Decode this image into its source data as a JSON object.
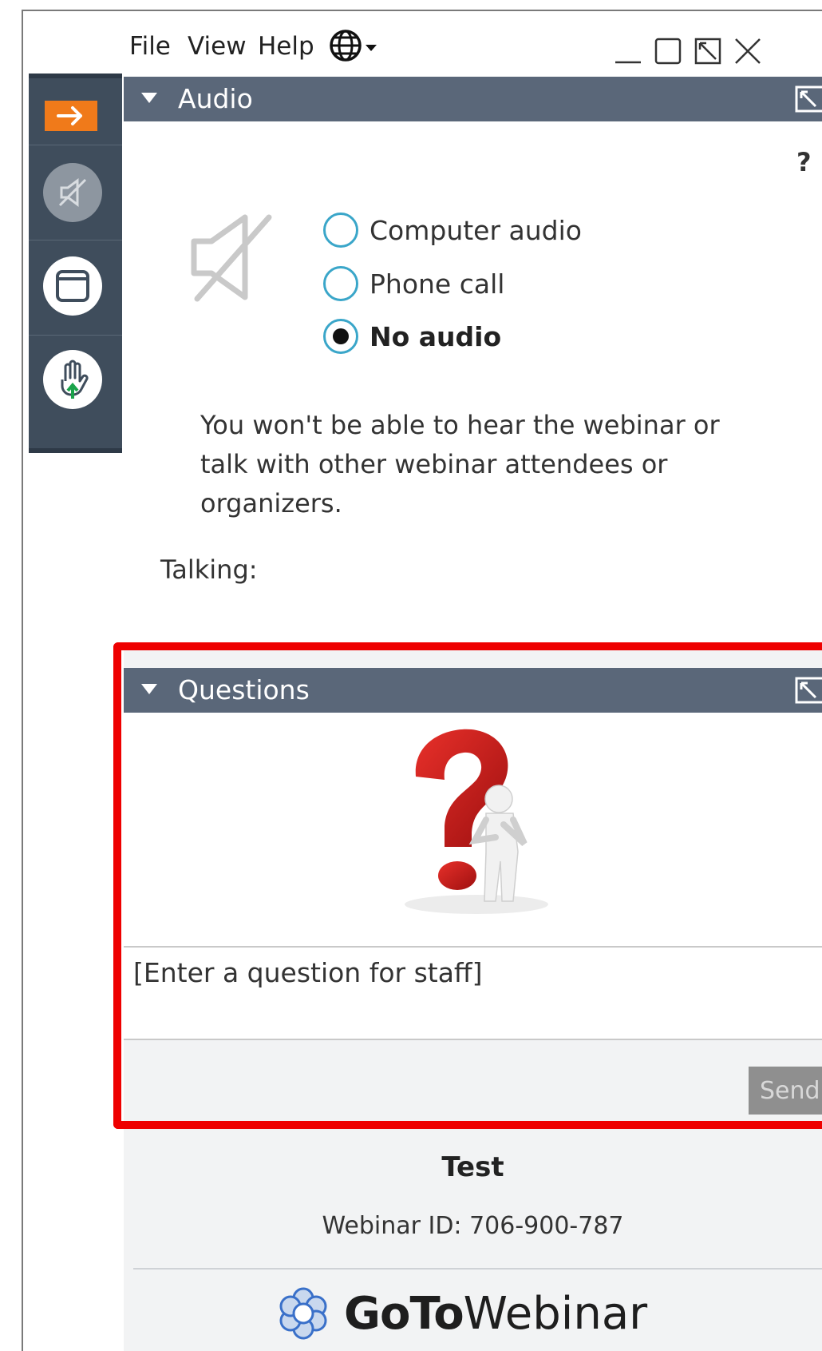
{
  "menu": {
    "items": [
      "File",
      "View",
      "Help"
    ],
    "language_icon": "globe-icon"
  },
  "window_controls": [
    "minimize-icon",
    "maximize-icon",
    "restore-icon",
    "close-icon"
  ],
  "sidebar": {
    "items": [
      "collapse-arrow-icon",
      "audio-muted-icon",
      "screen-view-icon",
      "raise-hand-icon"
    ]
  },
  "audio": {
    "title": "Audio",
    "help": "?",
    "options": [
      {
        "label": "Computer audio",
        "selected": false
      },
      {
        "label": "Phone call",
        "selected": false
      },
      {
        "label": "No audio",
        "selected": true
      }
    ],
    "note": "You won't be able to hear the webinar or talk with other webinar attendees or organizers.",
    "talking_label": "Talking:"
  },
  "questions": {
    "title": "Questions",
    "input_placeholder": "[Enter a question for staff]",
    "send_label": "Send"
  },
  "footer": {
    "webinar_name": "Test",
    "webinar_id": "Webinar ID: 706-900-787",
    "logo_bold": "GoTo",
    "logo_regular": "Webinar"
  },
  "colors": {
    "header_bg": "#5a6779",
    "sidebar_bg": "#3f4d5c",
    "accent_orange": "#f07a1a",
    "radio_ring": "#3aa6c9",
    "highlight_red": "#ee0000"
  }
}
